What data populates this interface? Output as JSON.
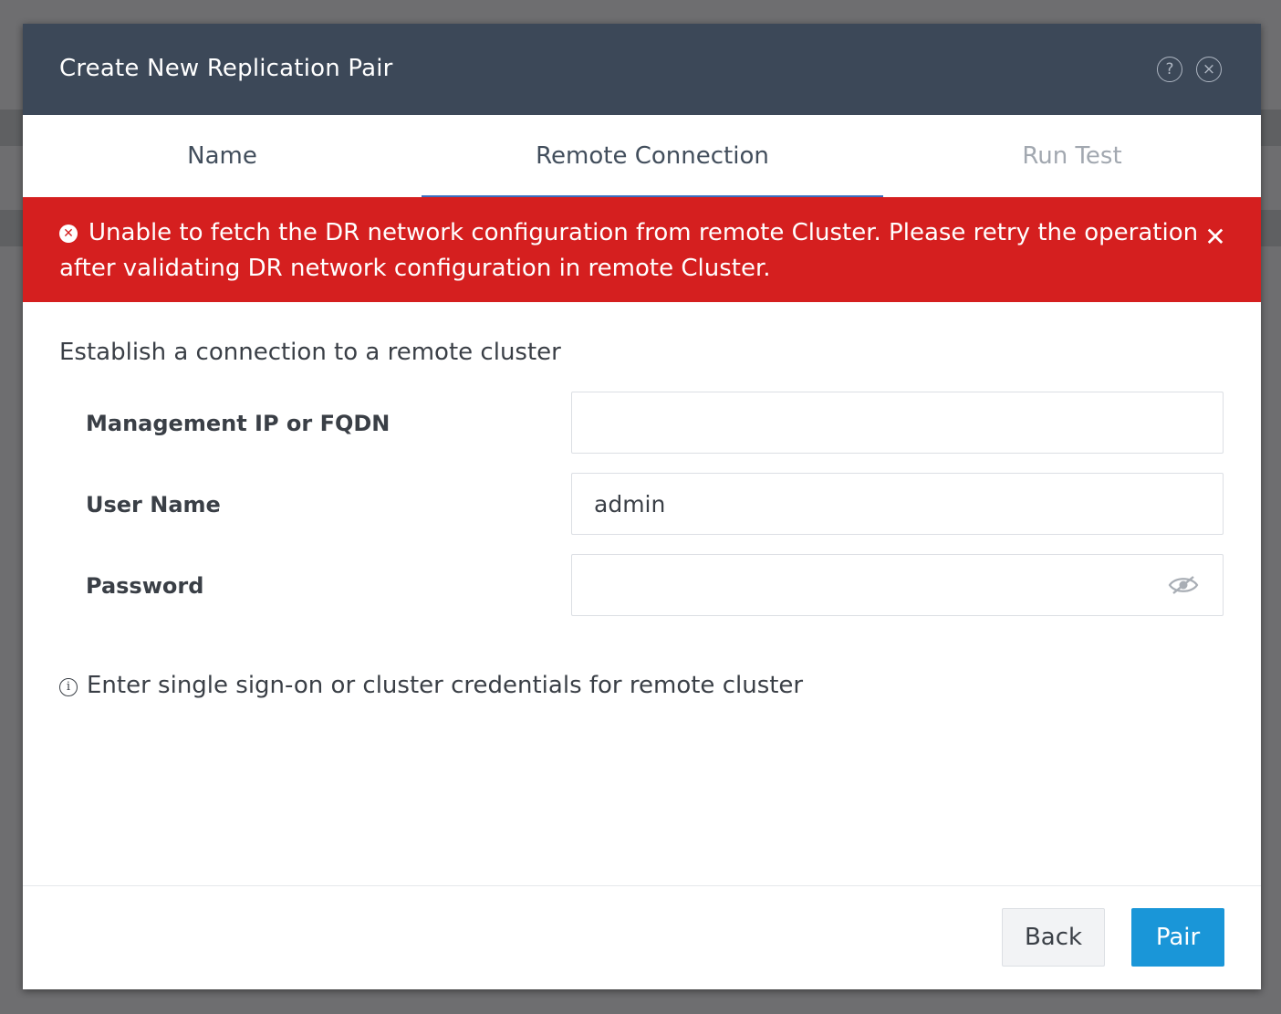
{
  "dialog": {
    "title": "Create New Replication Pair",
    "help_icon": "help-circle-icon",
    "close_icon": "close-circle-icon"
  },
  "tabs": [
    {
      "label": "Name",
      "state": "completed"
    },
    {
      "label": "Remote Connection",
      "state": "active"
    },
    {
      "label": "Run Test",
      "state": "disabled"
    }
  ],
  "error_banner": {
    "icon": "error-circle-icon",
    "message": "Unable to fetch the DR network configuration from remote Cluster. Please retry the operation after validating DR network configuration in remote Cluster.",
    "close_icon": "close-x-icon"
  },
  "form": {
    "heading": "Establish a connection to a remote cluster",
    "management_ip": {
      "label": "Management IP or FQDN",
      "value": ""
    },
    "user_name": {
      "label": "User Name",
      "value": "admin"
    },
    "password": {
      "label": "Password",
      "value": "",
      "toggle_icon": "eye-slash-icon"
    },
    "hint": "Enter single sign-on or cluster credentials for remote cluster",
    "hint_icon": "info-icon"
  },
  "footer": {
    "back_label": "Back",
    "pair_label": "Pair"
  },
  "colors": {
    "header_bg": "#3c4858",
    "error_bg": "#d51f1f",
    "primary": "#1a96d8",
    "active_tab_underline": "#3b6fc0"
  }
}
